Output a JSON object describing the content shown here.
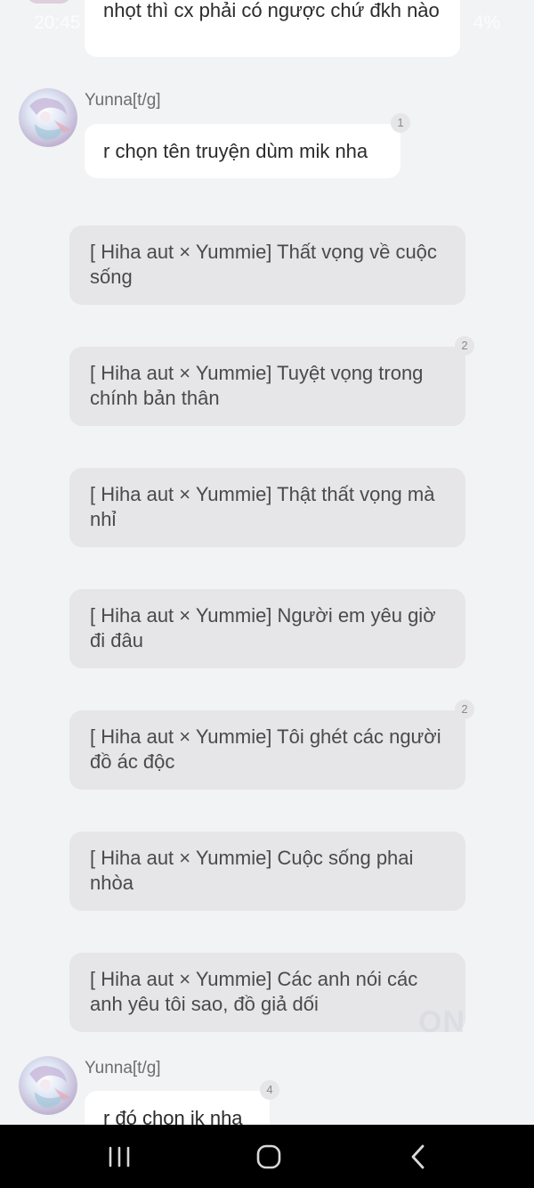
{
  "status_bar": {
    "time": "20:45",
    "battery": "4%"
  },
  "messages": [
    {
      "text": "nhọt thì cx phải có ngược chứ đkh nào"
    },
    {
      "sender": "Yunna[t/g]",
      "text": "r chọn tên truyện dùm mik nha",
      "reaction_count": "1"
    },
    {
      "sender": "Yunna[t/g]",
      "text": "r đó chọn ik nha",
      "reaction_count": "4"
    }
  ],
  "options": [
    {
      "text": "[ Hiha aut × Yummie] Thất vọng về cuộc sống",
      "count": ""
    },
    {
      "text": "[ Hiha aut × Yummie] Tuyệt vọng trong chính bản thân",
      "count": "2"
    },
    {
      "text": "[ Hiha aut × Yummie] Thật thất vọng mà nhỉ",
      "count": ""
    },
    {
      "text": "[ Hiha aut × Yummie] Người em yêu giờ đi đâu",
      "count": ""
    },
    {
      "text": "[ Hiha aut × Yummie] Tôi ghét các người đồ ác độc",
      "count": "2"
    },
    {
      "text": "[ Hiha aut × Yummie] Cuộc sống phai nhòa",
      "count": ""
    },
    {
      "text": "[ Hiha aut × Yummie] Các anh nói các anh yêu tôi sao, đồ giả dối",
      "count": ""
    }
  ],
  "watermark": "ON",
  "icons": {
    "recent_apps": "recent-apps-icon",
    "home": "home-icon",
    "back": "back-icon"
  },
  "colors": {
    "background": "#f2f3f5",
    "bubble": "#ffffff",
    "option_bubble": "#e6e6e8",
    "nav_bar": "#000000"
  }
}
